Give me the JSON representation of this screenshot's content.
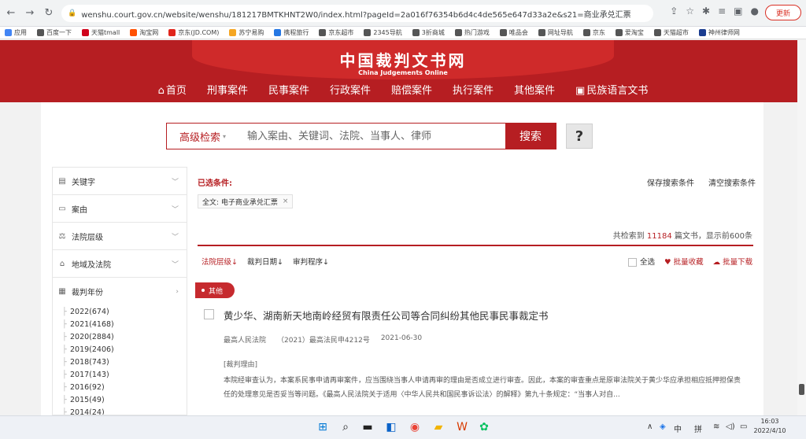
{
  "browser": {
    "url": "wenshu.court.gov.cn/website/wenshu/181217BMTKHNT2W0/index.html?pageId=2a016f76354b6d4c4de565e647d33a2e&s21=商业承兑汇票",
    "update_label": "更新",
    "bookmarks": [
      {
        "label": "应用",
        "color": "#4285f4"
      },
      {
        "label": "百度一下",
        "color": "#555555"
      },
      {
        "label": "天猫tmall",
        "color": "#d0021b"
      },
      {
        "label": "淘宝网",
        "color": "#ff5000"
      },
      {
        "label": "京东(JD.COM)",
        "color": "#e1251b"
      },
      {
        "label": "苏宁易购",
        "color": "#f5a623"
      },
      {
        "label": "携程旅行",
        "color": "#2577e3"
      },
      {
        "label": "京东超市",
        "color": "#555555"
      },
      {
        "label": "2345导航",
        "color": "#555555"
      },
      {
        "label": "3折商城",
        "color": "#555555"
      },
      {
        "label": "热门游戏",
        "color": "#555555"
      },
      {
        "label": "唯品会",
        "color": "#555555"
      },
      {
        "label": "网址导航",
        "color": "#555555"
      },
      {
        "label": "京东",
        "color": "#555555"
      },
      {
        "label": "爱淘宝",
        "color": "#555555"
      },
      {
        "label": "天猫超市",
        "color": "#555555"
      },
      {
        "label": "神州律师网",
        "color": "#1a3c8f"
      }
    ]
  },
  "site": {
    "logo_cn": "中国裁判文书网",
    "logo_en": "China Judgements Online",
    "nav": [
      {
        "label": "首页",
        "icon": "home-icon"
      },
      {
        "label": "刑事案件"
      },
      {
        "label": "民事案件"
      },
      {
        "label": "行政案件"
      },
      {
        "label": "赔偿案件"
      },
      {
        "label": "执行案件"
      },
      {
        "label": "其他案件"
      },
      {
        "label": "民族语言文书",
        "icon": "book-icon"
      }
    ]
  },
  "search": {
    "advanced_label": "高级检索",
    "placeholder": "输入案由、关键词、法院、当事人、律师",
    "button_label": "搜索",
    "help_label": "?"
  },
  "sidebar": {
    "items": [
      {
        "label": "关键字",
        "icon": "document-icon"
      },
      {
        "label": "案由",
        "icon": "card-icon"
      },
      {
        "label": "法院层级",
        "icon": "scale-icon"
      },
      {
        "label": "地域及法院",
        "icon": "building-icon"
      },
      {
        "label": "裁判年份",
        "icon": "calendar-icon"
      }
    ],
    "years": [
      "2022(674)",
      "2021(4168)",
      "2020(2884)",
      "2019(2406)",
      "2018(743)",
      "2017(143)",
      "2016(92)",
      "2015(49)",
      "2014(24)"
    ]
  },
  "filters": {
    "label": "已选条件:",
    "save_label": "保存搜索条件",
    "clear_label": "清空搜索条件",
    "tag": "全文: 电子商业承兑汇票",
    "tag_close": "×"
  },
  "results": {
    "count_prefix": "共检索到",
    "count": "11184",
    "count_suffix": "篇文书，显示前600条",
    "sort": [
      "法院层级↓",
      "裁判日期↓",
      "审判程序↓"
    ],
    "select_all": "全选",
    "batch_collect": "批量收藏",
    "batch_download": "批量下载",
    "category_tag": "其他",
    "doc": {
      "title": "黄少华、湖南新天地南岭经贸有限责任公司等合同纠纷其他民事民事裁定书",
      "court": "最高人民法院",
      "case_no": "（2021）最高法民申4212号",
      "date": "2021-06-30",
      "reason_label": "[裁判理由]",
      "snippet": "本院经审查认为，本案系民事申请再审案件，应当围绕当事人申请再审的理由是否成立进行审查。因此，本案的审查重点是原审法院关于黄少华应承担相应抵押担保责任的处理意见是否妥当等问题。《最高人民法院关于适用〈中华人民共和国民事诉讼法〉的解释》第九十条规定：“当事人对自..."
    }
  },
  "taskbar": {
    "ime": "中",
    "ime2": "拼",
    "time": "16:03",
    "date": "2022/4/10"
  },
  "colors": {
    "brand": "#b61e22"
  }
}
